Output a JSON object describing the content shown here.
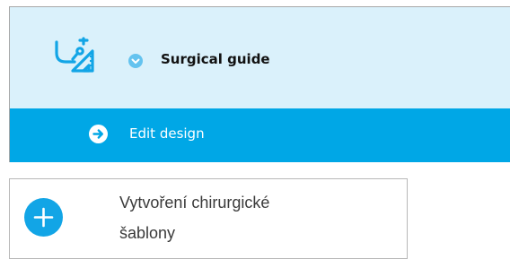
{
  "header": {
    "title": "Surgical guide",
    "app_icon": "surgical-guide-icon",
    "step_icon": "chevron-down-icon"
  },
  "action_bar": {
    "label": "Edit design",
    "icon": "arrow-right-circle-icon"
  },
  "task": {
    "icon": "plus-icon",
    "line1": "Vytvoření chirurgické",
    "line2": "šablony"
  },
  "colors": {
    "header_bg": "#daf1fb",
    "action_bg": "#00a7e6",
    "accent": "#12a5e6",
    "step_dot": "#64c3ef"
  }
}
